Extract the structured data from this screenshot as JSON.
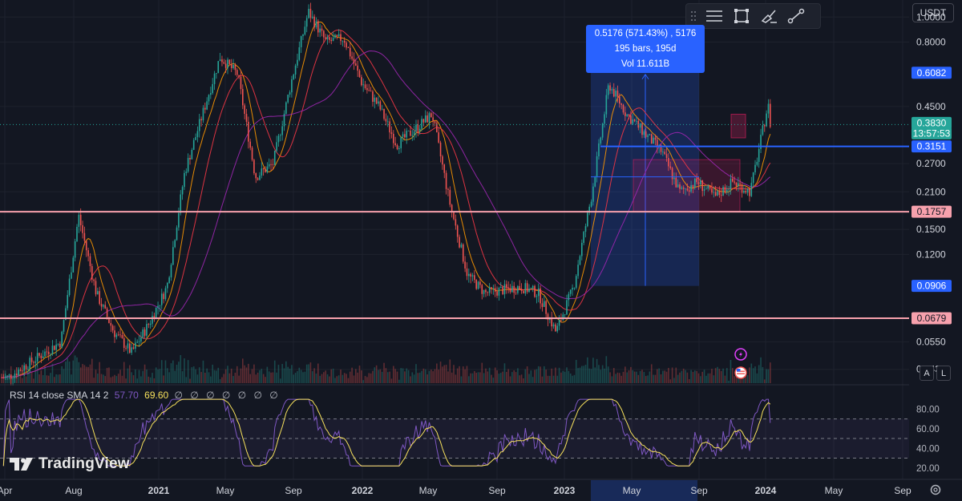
{
  "toolbar": {
    "tools": [
      {
        "icon": "horizontal-lines-icon"
      },
      {
        "icon": "rectangle-icon"
      },
      {
        "icon": "brush-icon"
      },
      {
        "icon": "trend-line-icon"
      }
    ]
  },
  "currency_label": "USDT",
  "tooltip": {
    "line1": "0.5176 (571.43%) , 5176",
    "line2": "195 bars, 195d",
    "line3": "Vol 11.611B"
  },
  "price_scale": {
    "ticks": [
      "1.0000",
      "0.8000",
      "0.4500",
      "0.2700",
      "0.2100",
      "0.1500",
      "0.1200",
      "0.0550",
      "0.0430"
    ],
    "badges": [
      {
        "label": "0.6082",
        "color": "#2962ff",
        "text_color": "#ffffff"
      },
      {
        "label": "0.3830",
        "color": "#26a69a",
        "text_color": "#ffffff"
      },
      {
        "label": "13:57:53",
        "color": "#26a69a",
        "text_color": "#ffffff"
      },
      {
        "label": "0.3151",
        "color": "#2962ff",
        "text_color": "#ffffff"
      },
      {
        "label": "0.1757",
        "color": "#f7a1ad",
        "text_color": "#131722"
      },
      {
        "label": "0.0906",
        "color": "#2962ff",
        "text_color": "#ffffff"
      },
      {
        "label": "0.0679",
        "color": "#f7a1ad",
        "text_color": "#131722"
      }
    ]
  },
  "rsi": {
    "legend_name": "RSI",
    "legend_params": "14 close SMA 14 2",
    "value": "57.70",
    "ma_value": "69.60",
    "legend_icons": "∅ ∅ ∅ ∅ ∅ ∅ ∅",
    "ticks": [
      "80.00",
      "60.00",
      "40.00",
      "20.00"
    ]
  },
  "time_axis": {
    "labels": [
      "Apr",
      "Aug",
      "2021",
      "May",
      "Sep",
      "2022",
      "May",
      "Sep",
      "2023",
      "May",
      "Sep",
      "2024",
      "May",
      "Sep"
    ]
  },
  "buttons": {
    "auto": "A",
    "log": "L"
  },
  "logo": {
    "text": "TradingView"
  },
  "colors": {
    "background": "#131722",
    "candle_up": "#26a69a",
    "candle_down": "#ef5350",
    "ma_orange": "#ff9800",
    "ma_red": "#f23645",
    "ma_purple": "#9c27b0",
    "rsi_line": "#7e57c2",
    "rsi_ma": "#f7e15c",
    "hline_blue": "#2962ff",
    "hline_pink": "#f7a1ad",
    "measure_fill": "#2962ff"
  },
  "chart_data": {
    "type": "candlestick",
    "scale": "log",
    "y_range": [
      0.038,
      1.1
    ],
    "horizontal_levels": [
      0.3151,
      0.1757,
      0.0679
    ],
    "measure_range": {
      "low": 0.0906,
      "high": 0.6082,
      "change": "0.5176 (571.43%)",
      "bars": 195,
      "days": 195,
      "volume": "11.611B"
    },
    "last_price": 0.383,
    "price_path": [
      {
        "x": "2020-04",
        "y": 0.04
      },
      {
        "x": "2020-07",
        "y": 0.055
      },
      {
        "x": "2020-08",
        "y": 0.17
      },
      {
        "x": "2020-09",
        "y": 0.085
      },
      {
        "x": "2020-10",
        "y": 0.06
      },
      {
        "x": "2020-11",
        "y": 0.05
      },
      {
        "x": "2020-12",
        "y": 0.065
      },
      {
        "x": "2021-01",
        "y": 0.09
      },
      {
        "x": "2021-02",
        "y": 0.25
      },
      {
        "x": "2021-04",
        "y": 0.7
      },
      {
        "x": "2021-05",
        "y": 0.6
      },
      {
        "x": "2021-06",
        "y": 0.24
      },
      {
        "x": "2021-07",
        "y": 0.27
      },
      {
        "x": "2021-08",
        "y": 0.55
      },
      {
        "x": "2021-09",
        "y": 1.05
      },
      {
        "x": "2021-10",
        "y": 0.8
      },
      {
        "x": "2021-11",
        "y": 0.83
      },
      {
        "x": "2021-12",
        "y": 0.56
      },
      {
        "x": "2022-01",
        "y": 0.45
      },
      {
        "x": "2022-02",
        "y": 0.32
      },
      {
        "x": "2022-04",
        "y": 0.42
      },
      {
        "x": "2022-05",
        "y": 0.19
      },
      {
        "x": "2022-06",
        "y": 0.1
      },
      {
        "x": "2022-07",
        "y": 0.085
      },
      {
        "x": "2022-09",
        "y": 0.09
      },
      {
        "x": "2022-10",
        "y": 0.085
      },
      {
        "x": "2022-11",
        "y": 0.06
      },
      {
        "x": "2022-12",
        "y": 0.09
      },
      {
        "x": "2023-01",
        "y": 0.2
      },
      {
        "x": "2023-02",
        "y": 0.55
      },
      {
        "x": "2023-03",
        "y": 0.42
      },
      {
        "x": "2023-05",
        "y": 0.3
      },
      {
        "x": "2023-06",
        "y": 0.21
      },
      {
        "x": "2023-07",
        "y": 0.23
      },
      {
        "x": "2023-08",
        "y": 0.2
      },
      {
        "x": "2023-09",
        "y": 0.23
      },
      {
        "x": "2023-10",
        "y": 0.21
      },
      {
        "x": "2023-11",
        "y": 0.46
      },
      {
        "x": "2023-11-20",
        "y": 0.383
      }
    ],
    "rsi_range": [
      20,
      80
    ]
  }
}
